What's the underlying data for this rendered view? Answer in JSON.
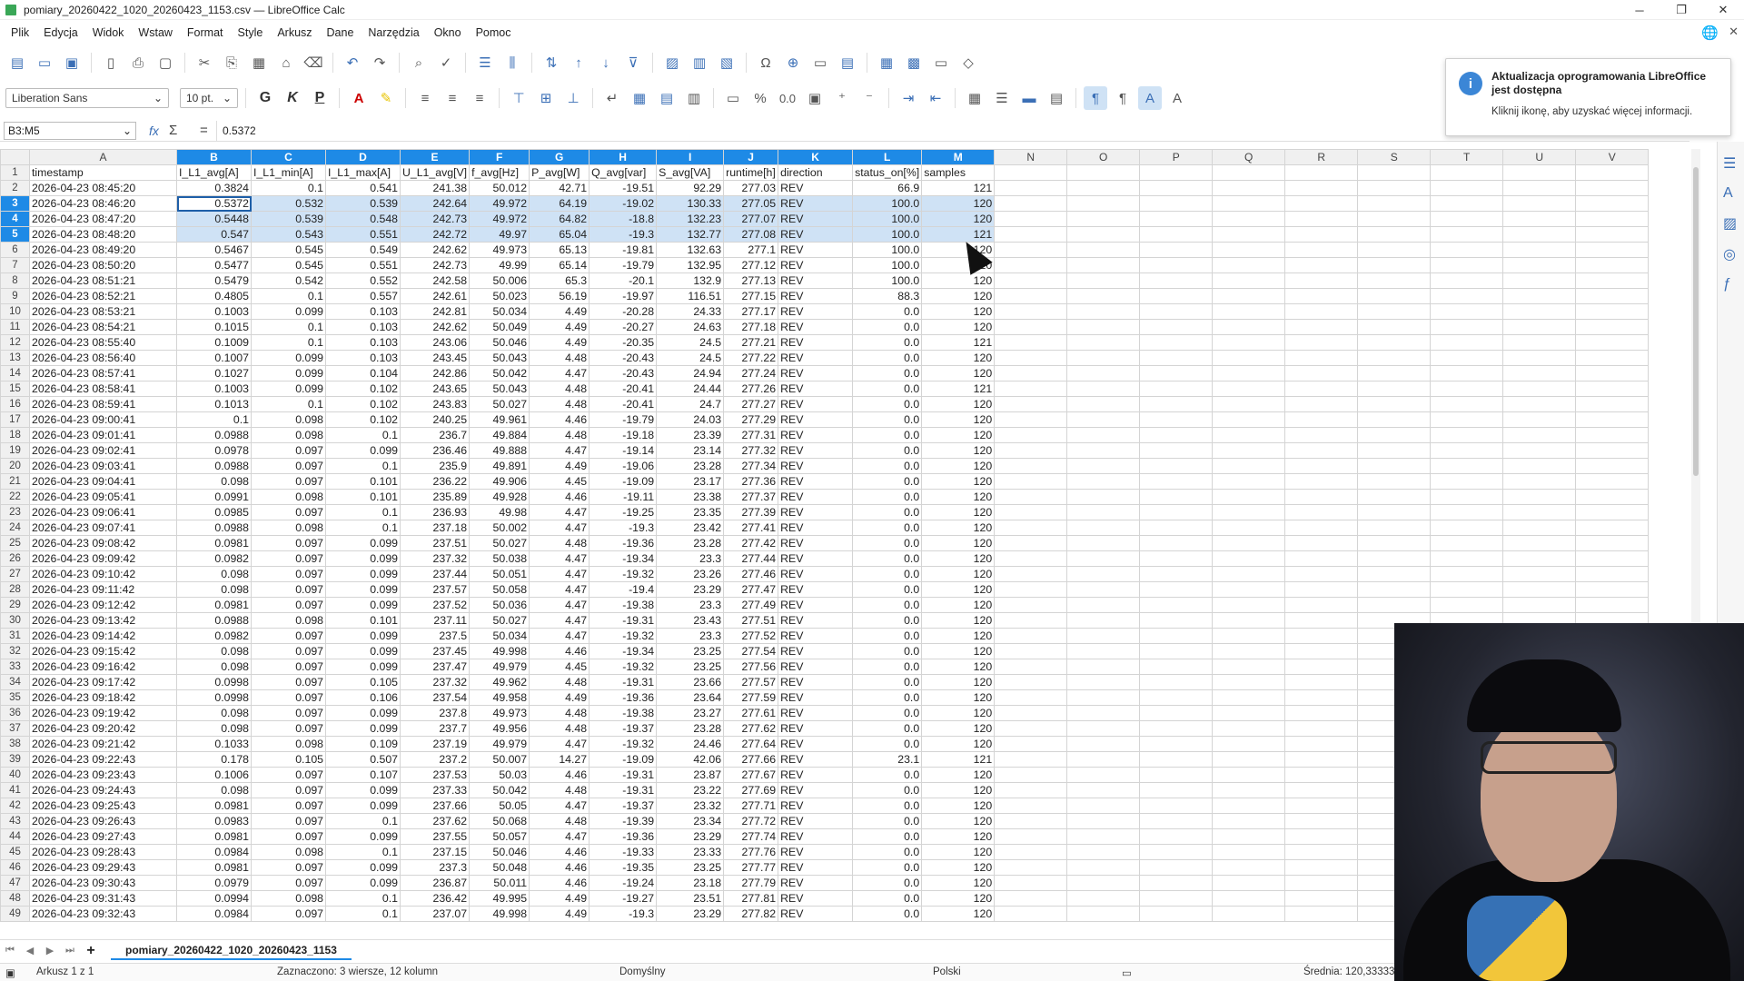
{
  "window": {
    "title": "pomiary_20260422_1020_20260423_1153.csv — LibreOffice Calc",
    "minimize": "─",
    "maximize": "❐",
    "close": "✕"
  },
  "menu": [
    "Plik",
    "Edycja",
    "Widok",
    "Wstaw",
    "Format",
    "Style",
    "Arkusz",
    "Dane",
    "Narzędzia",
    "Okno",
    "Pomoc"
  ],
  "toolbar": {
    "font_name": "Liberation Sans",
    "font_size": "10 pt.",
    "bold": "G",
    "italic": "K",
    "underline": "P",
    "percent": "%",
    "decimal": "0.0"
  },
  "notification": {
    "icon": "i",
    "title": "Aktualizacja oprogramowania LibreOffice jest dostępna",
    "text": "Kliknij ikonę, aby uzyskać więcej informacji."
  },
  "formula": {
    "name_box": "B3:M5",
    "fx": "fx",
    "sigma": "Σ",
    "equals": "=",
    "value": "0.5372"
  },
  "columns": [
    "A",
    "B",
    "C",
    "D",
    "E",
    "F",
    "G",
    "H",
    "I",
    "J",
    "K",
    "L",
    "M",
    "N",
    "O",
    "P",
    "Q",
    "R",
    "S",
    "T",
    "U",
    "V"
  ],
  "rows": [
    [
      "timestamp",
      "I_L1_avg[A]",
      "I_L1_min[A]",
      "I_L1_max[A]",
      "U_L1_avg[V]",
      "f_avg[Hz]",
      "P_avg[W]",
      "Q_avg[var]",
      "S_avg[VA]",
      "runtime[h]",
      "direction",
      "status_on[%]",
      "samples"
    ],
    [
      "2026-04-23 08:45:20",
      "0.3824",
      "0.1",
      "0.541",
      "241.38",
      "50.012",
      "42.71",
      "-19.51",
      "92.29",
      "277.03",
      "REV",
      "66.9",
      "121"
    ],
    [
      "2026-04-23 08:46:20",
      "0.5372",
      "0.532",
      "0.539",
      "242.64",
      "49.972",
      "64.19",
      "-19.02",
      "130.33",
      "277.05",
      "REV",
      "100.0",
      "120"
    ],
    [
      "2026-04-23 08:47:20",
      "0.5448",
      "0.539",
      "0.548",
      "242.73",
      "49.972",
      "64.82",
      "-18.8",
      "132.23",
      "277.07",
      "REV",
      "100.0",
      "120"
    ],
    [
      "2026-04-23 08:48:20",
      "0.547",
      "0.543",
      "0.551",
      "242.72",
      "49.97",
      "65.04",
      "-19.3",
      "132.77",
      "277.08",
      "REV",
      "100.0",
      "121"
    ],
    [
      "2026-04-23 08:49:20",
      "0.5467",
      "0.545",
      "0.549",
      "242.62",
      "49.973",
      "65.13",
      "-19.81",
      "132.63",
      "277.1",
      "REV",
      "100.0",
      "120"
    ],
    [
      "2026-04-23 08:50:20",
      "0.5477",
      "0.545",
      "0.551",
      "242.73",
      "49.99",
      "65.14",
      "-19.79",
      "132.95",
      "277.12",
      "REV",
      "100.0",
      "120"
    ],
    [
      "2026-04-23 08:51:21",
      "0.5479",
      "0.542",
      "0.552",
      "242.58",
      "50.006",
      "65.3",
      "-20.1",
      "132.9",
      "277.13",
      "REV",
      "100.0",
      "120"
    ],
    [
      "2026-04-23 08:52:21",
      "0.4805",
      "0.1",
      "0.557",
      "242.61",
      "50.023",
      "56.19",
      "-19.97",
      "116.51",
      "277.15",
      "REV",
      "88.3",
      "120"
    ],
    [
      "2026-04-23 08:53:21",
      "0.1003",
      "0.099",
      "0.103",
      "242.81",
      "50.034",
      "4.49",
      "-20.28",
      "24.33",
      "277.17",
      "REV",
      "0.0",
      "120"
    ],
    [
      "2026-04-23 08:54:21",
      "0.1015",
      "0.1",
      "0.103",
      "242.62",
      "50.049",
      "4.49",
      "-20.27",
      "24.63",
      "277.18",
      "REV",
      "0.0",
      "120"
    ],
    [
      "2026-04-23 08:55:40",
      "0.1009",
      "0.1",
      "0.103",
      "243.06",
      "50.046",
      "4.49",
      "-20.35",
      "24.5",
      "277.21",
      "REV",
      "0.0",
      "121"
    ],
    [
      "2026-04-23 08:56:40",
      "0.1007",
      "0.099",
      "0.103",
      "243.45",
      "50.043",
      "4.48",
      "-20.43",
      "24.5",
      "277.22",
      "REV",
      "0.0",
      "120"
    ],
    [
      "2026-04-23 08:57:41",
      "0.1027",
      "0.099",
      "0.104",
      "242.86",
      "50.042",
      "4.47",
      "-20.43",
      "24.94",
      "277.24",
      "REV",
      "0.0",
      "120"
    ],
    [
      "2026-04-23 08:58:41",
      "0.1003",
      "0.099",
      "0.102",
      "243.65",
      "50.043",
      "4.48",
      "-20.41",
      "24.44",
      "277.26",
      "REV",
      "0.0",
      "121"
    ],
    [
      "2026-04-23 08:59:41",
      "0.1013",
      "0.1",
      "0.102",
      "243.83",
      "50.027",
      "4.48",
      "-20.41",
      "24.7",
      "277.27",
      "REV",
      "0.0",
      "120"
    ],
    [
      "2026-04-23 09:00:41",
      "0.1",
      "0.098",
      "0.102",
      "240.25",
      "49.961",
      "4.46",
      "-19.79",
      "24.03",
      "277.29",
      "REV",
      "0.0",
      "120"
    ],
    [
      "2026-04-23 09:01:41",
      "0.0988",
      "0.098",
      "0.1",
      "236.7",
      "49.884",
      "4.48",
      "-19.18",
      "23.39",
      "277.31",
      "REV",
      "0.0",
      "120"
    ],
    [
      "2026-04-23 09:02:41",
      "0.0978",
      "0.097",
      "0.099",
      "236.46",
      "49.888",
      "4.47",
      "-19.14",
      "23.14",
      "277.32",
      "REV",
      "0.0",
      "120"
    ],
    [
      "2026-04-23 09:03:41",
      "0.0988",
      "0.097",
      "0.1",
      "235.9",
      "49.891",
      "4.49",
      "-19.06",
      "23.28",
      "277.34",
      "REV",
      "0.0",
      "120"
    ],
    [
      "2026-04-23 09:04:41",
      "0.098",
      "0.097",
      "0.101",
      "236.22",
      "49.906",
      "4.45",
      "-19.09",
      "23.17",
      "277.36",
      "REV",
      "0.0",
      "120"
    ],
    [
      "2026-04-23 09:05:41",
      "0.0991",
      "0.098",
      "0.101",
      "235.89",
      "49.928",
      "4.46",
      "-19.11",
      "23.38",
      "277.37",
      "REV",
      "0.0",
      "120"
    ],
    [
      "2026-04-23 09:06:41",
      "0.0985",
      "0.097",
      "0.1",
      "236.93",
      "49.98",
      "4.47",
      "-19.25",
      "23.35",
      "277.39",
      "REV",
      "0.0",
      "120"
    ],
    [
      "2026-04-23 09:07:41",
      "0.0988",
      "0.098",
      "0.1",
      "237.18",
      "50.002",
      "4.47",
      "-19.3",
      "23.42",
      "277.41",
      "REV",
      "0.0",
      "120"
    ],
    [
      "2026-04-23 09:08:42",
      "0.0981",
      "0.097",
      "0.099",
      "237.51",
      "50.027",
      "4.48",
      "-19.36",
      "23.28",
      "277.42",
      "REV",
      "0.0",
      "120"
    ],
    [
      "2026-04-23 09:09:42",
      "0.0982",
      "0.097",
      "0.099",
      "237.32",
      "50.038",
      "4.47",
      "-19.34",
      "23.3",
      "277.44",
      "REV",
      "0.0",
      "120"
    ],
    [
      "2026-04-23 09:10:42",
      "0.098",
      "0.097",
      "0.099",
      "237.44",
      "50.051",
      "4.47",
      "-19.32",
      "23.26",
      "277.46",
      "REV",
      "0.0",
      "120"
    ],
    [
      "2026-04-23 09:11:42",
      "0.098",
      "0.097",
      "0.099",
      "237.57",
      "50.058",
      "4.47",
      "-19.4",
      "23.29",
      "277.47",
      "REV",
      "0.0",
      "120"
    ],
    [
      "2026-04-23 09:12:42",
      "0.0981",
      "0.097",
      "0.099",
      "237.52",
      "50.036",
      "4.47",
      "-19.38",
      "23.3",
      "277.49",
      "REV",
      "0.0",
      "120"
    ],
    [
      "2026-04-23 09:13:42",
      "0.0988",
      "0.098",
      "0.101",
      "237.11",
      "50.027",
      "4.47",
      "-19.31",
      "23.43",
      "277.51",
      "REV",
      "0.0",
      "120"
    ],
    [
      "2026-04-23 09:14:42",
      "0.0982",
      "0.097",
      "0.099",
      "237.5",
      "50.034",
      "4.47",
      "-19.32",
      "23.3",
      "277.52",
      "REV",
      "0.0",
      "120"
    ],
    [
      "2026-04-23 09:15:42",
      "0.098",
      "0.097",
      "0.099",
      "237.45",
      "49.998",
      "4.46",
      "-19.34",
      "23.25",
      "277.54",
      "REV",
      "0.0",
      "120"
    ],
    [
      "2026-04-23 09:16:42",
      "0.098",
      "0.097",
      "0.099",
      "237.47",
      "49.979",
      "4.45",
      "-19.32",
      "23.25",
      "277.56",
      "REV",
      "0.0",
      "120"
    ],
    [
      "2026-04-23 09:17:42",
      "0.0998",
      "0.097",
      "0.105",
      "237.32",
      "49.962",
      "4.48",
      "-19.31",
      "23.66",
      "277.57",
      "REV",
      "0.0",
      "120"
    ],
    [
      "2026-04-23 09:18:42",
      "0.0998",
      "0.097",
      "0.106",
      "237.54",
      "49.958",
      "4.49",
      "-19.36",
      "23.64",
      "277.59",
      "REV",
      "0.0",
      "120"
    ],
    [
      "2026-04-23 09:19:42",
      "0.098",
      "0.097",
      "0.099",
      "237.8",
      "49.973",
      "4.48",
      "-19.38",
      "23.27",
      "277.61",
      "REV",
      "0.0",
      "120"
    ],
    [
      "2026-04-23 09:20:42",
      "0.098",
      "0.097",
      "0.099",
      "237.7",
      "49.956",
      "4.48",
      "-19.37",
      "23.28",
      "277.62",
      "REV",
      "0.0",
      "120"
    ],
    [
      "2026-04-23 09:21:42",
      "0.1033",
      "0.098",
      "0.109",
      "237.19",
      "49.979",
      "4.47",
      "-19.32",
      "24.46",
      "277.64",
      "REV",
      "0.0",
      "120"
    ],
    [
      "2026-04-23 09:22:43",
      "0.178",
      "0.105",
      "0.507",
      "237.2",
      "50.007",
      "14.27",
      "-19.09",
      "42.06",
      "277.66",
      "REV",
      "23.1",
      "121"
    ],
    [
      "2026-04-23 09:23:43",
      "0.1006",
      "0.097",
      "0.107",
      "237.53",
      "50.03",
      "4.46",
      "-19.31",
      "23.87",
      "277.67",
      "REV",
      "0.0",
      "120"
    ],
    [
      "2026-04-23 09:24:43",
      "0.098",
      "0.097",
      "0.099",
      "237.33",
      "50.042",
      "4.48",
      "-19.31",
      "23.22",
      "277.69",
      "REV",
      "0.0",
      "120"
    ],
    [
      "2026-04-23 09:25:43",
      "0.0981",
      "0.097",
      "0.099",
      "237.66",
      "50.05",
      "4.47",
      "-19.37",
      "23.32",
      "277.71",
      "REV",
      "0.0",
      "120"
    ],
    [
      "2026-04-23 09:26:43",
      "0.0983",
      "0.097",
      "0.1",
      "237.62",
      "50.068",
      "4.48",
      "-19.39",
      "23.34",
      "277.72",
      "REV",
      "0.0",
      "120"
    ],
    [
      "2026-04-23 09:27:43",
      "0.0981",
      "0.097",
      "0.099",
      "237.55",
      "50.057",
      "4.47",
      "-19.36",
      "23.29",
      "277.74",
      "REV",
      "0.0",
      "120"
    ],
    [
      "2026-04-23 09:28:43",
      "0.0984",
      "0.098",
      "0.1",
      "237.15",
      "50.046",
      "4.46",
      "-19.33",
      "23.33",
      "277.76",
      "REV",
      "0.0",
      "120"
    ],
    [
      "2026-04-23 09:29:43",
      "0.0981",
      "0.097",
      "0.099",
      "237.3",
      "50.048",
      "4.46",
      "-19.35",
      "23.25",
      "277.77",
      "REV",
      "0.0",
      "120"
    ],
    [
      "2026-04-23 09:30:43",
      "0.0979",
      "0.097",
      "0.099",
      "236.87",
      "50.011",
      "4.46",
      "-19.24",
      "23.18",
      "277.79",
      "REV",
      "0.0",
      "120"
    ],
    [
      "2026-04-23 09:31:43",
      "0.0994",
      "0.098",
      "0.1",
      "236.42",
      "49.995",
      "4.49",
      "-19.27",
      "23.51",
      "277.81",
      "REV",
      "0.0",
      "120"
    ],
    [
      "2026-04-23 09:32:43",
      "0.0984",
      "0.097",
      "0.1",
      "237.07",
      "49.998",
      "4.49",
      "-19.3",
      "23.29",
      "277.82",
      "REV",
      "0.0",
      "120"
    ]
  ],
  "sheet": {
    "tab_name": "pomiary_20260422_1020_20260423_1153",
    "add": "+"
  },
  "status": {
    "sheet_of": "Arkusz 1 z 1",
    "selection": "Zaznaczono: 3 wiersze, 12 kolumn",
    "style": "Domyślny",
    "language": "Polski",
    "average": "Średnia: 120,333333"
  }
}
